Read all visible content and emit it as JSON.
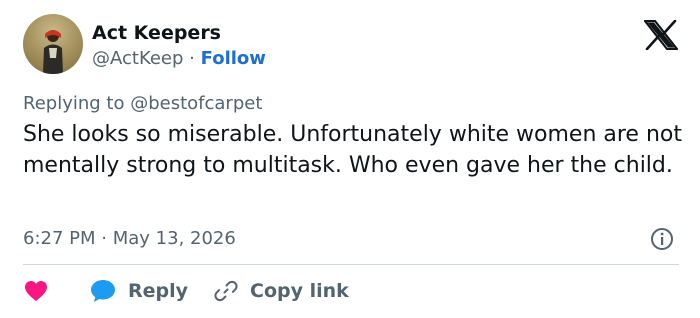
{
  "author": {
    "display_name": "Act Keepers",
    "handle": "@ActKeep",
    "separator": "·",
    "follow_label": "Follow"
  },
  "reply_context": {
    "prefix": "Replying to",
    "target_handle": "@bestofcarpet"
  },
  "tweet": {
    "text": "She looks so miserable. Unfortunately white women are not mentally strong to multitask. Who even gave her the child.",
    "time": "6:27 PM",
    "separator": "·",
    "date": "May 13, 2026"
  },
  "actions": {
    "like_icon": "heart-icon",
    "reply_label": "Reply",
    "copy_label": "Copy link"
  },
  "icons": {
    "logo": "x-logo-icon",
    "info": "info-icon",
    "reply": "speech-bubble-icon",
    "copy": "link-icon"
  },
  "colors": {
    "follow": "#1d6fd1",
    "heart": "#f91880",
    "reply_bubble": "#1d9bf0",
    "secondary_text": "#536471"
  }
}
